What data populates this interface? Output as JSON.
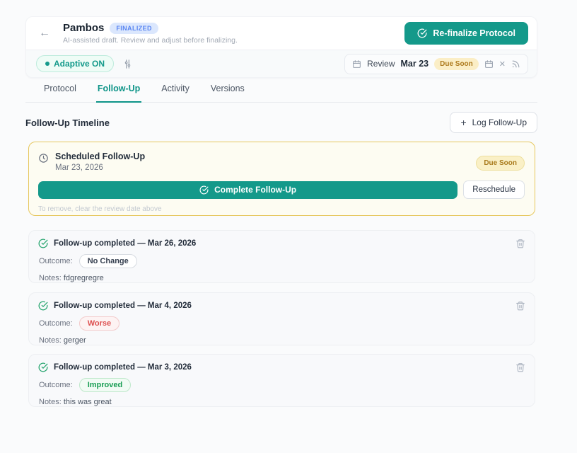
{
  "header": {
    "back_icon": "←",
    "title": "Pambos",
    "status_badge": "FINALIZED",
    "subtitle": "AI-assisted draft. Review and adjust before finalizing.",
    "refinalize_button": "Re-finalize Protocol",
    "adaptive_pill": "Adaptive ON",
    "review": {
      "label": "Review",
      "date": "Mar 23",
      "badge": "Due Soon",
      "close_icon": "✕"
    }
  },
  "tabs": [
    {
      "label": "Protocol",
      "active": false
    },
    {
      "label": "Follow-Up",
      "active": true
    },
    {
      "label": "Activity",
      "active": false
    },
    {
      "label": "Versions",
      "active": false
    }
  ],
  "section": {
    "title": "Follow-Up Timeline",
    "log_button": "Log Follow-Up",
    "plus_icon": "+"
  },
  "scheduled": {
    "title": "Scheduled Follow-Up",
    "date": "Mar 23, 2026",
    "badge": "Due Soon",
    "complete_button": "Complete Follow-Up",
    "reschedule_button": "Reschedule",
    "note": "To remove, clear the review date above"
  },
  "labels": {
    "outcome": "Outcome:",
    "notes": "Notes:"
  },
  "entries": [
    {
      "title": "Follow-up completed — Mar 26, 2026",
      "outcome": "No Change",
      "outcome_type": "neutral",
      "notes": "fdgregregre"
    },
    {
      "title": "Follow-up completed — Mar 4, 2026",
      "outcome": "Worse",
      "outcome_type": "worse",
      "notes": "gerger"
    },
    {
      "title": "Follow-up completed — Mar 3, 2026",
      "outcome": "Improved",
      "outcome_type": "improved",
      "notes": "this was great"
    }
  ],
  "colors": {
    "accent_teal": "#14998a",
    "badge_blue_bg": "#dbe7fd",
    "badge_blue_text": "#5a86f2",
    "due_soon_bg": "#fbeec6",
    "due_soon_text": "#ad7a1d",
    "scheduled_border": "#e6c75e",
    "worse_text": "#dd4f4f",
    "improved_text": "#199e54"
  }
}
